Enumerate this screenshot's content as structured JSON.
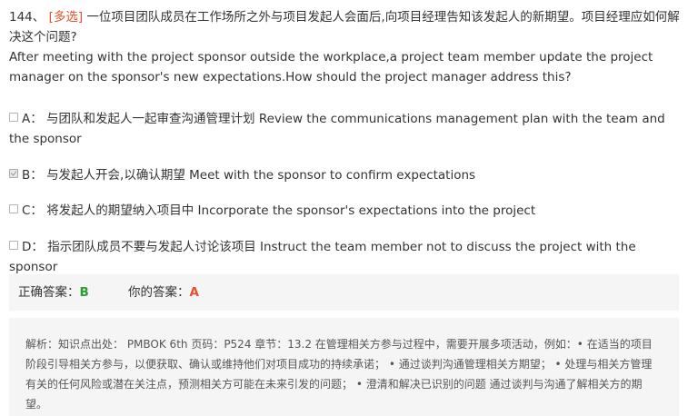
{
  "question": {
    "number": "144、",
    "tag": "[多选]",
    "text_cn": "一位项目团队成员在工作场所之外与项目发起人会面后,向项目经理告知该发起人的新期望。项目经理应如何解决这个问题?",
    "text_en": "After meeting with the project sponsor outside the workplace,a project team member update the project manager on the sponsor's new expectations.How should the project manager address this?"
  },
  "options": [
    {
      "letter": "A：",
      "text": "与团队和发起人一起审查沟通管理计划 Review the communications management plan with the team and the sponsor",
      "checked": false
    },
    {
      "letter": "B：",
      "text": "与发起人开会,以确认期望 Meet with the sponsor to confirm expectations",
      "checked": true
    },
    {
      "letter": "C：",
      "text": "将发起人的期望纳入项目中 Incorporate the sponsor's expectations into the project",
      "checked": false
    },
    {
      "letter": "D：",
      "text": "指示团队成员不要与发起人讨论该项目 Instruct the team member not to discuss the project with the sponsor",
      "checked": false
    }
  ],
  "answer": {
    "correct_label": "正确答案：",
    "correct_value": "B",
    "yours_label": "你的答案：",
    "yours_value": "A",
    "correct_color": "#2a9d2a",
    "wrong_color": "#e2532d"
  },
  "analysis": {
    "text": "解析：知识点出处： PMBOK 6th 页码：P524 章节：13.2 在管理相关方参与过程中，需要开展多项活动，例如：• 在适当的项目阶段引导相关方参与，以便获取、确认或维持他们对项目成功的持续承诺； • 通过谈判沟通管理相关方期望； • 处理与相关方管理有关的任何风险或潜在关注点，预测相关方可能在未来引发的问题； • 澄清和解决已识别的问题 通过谈判与沟通了解相关方的期望。"
  }
}
